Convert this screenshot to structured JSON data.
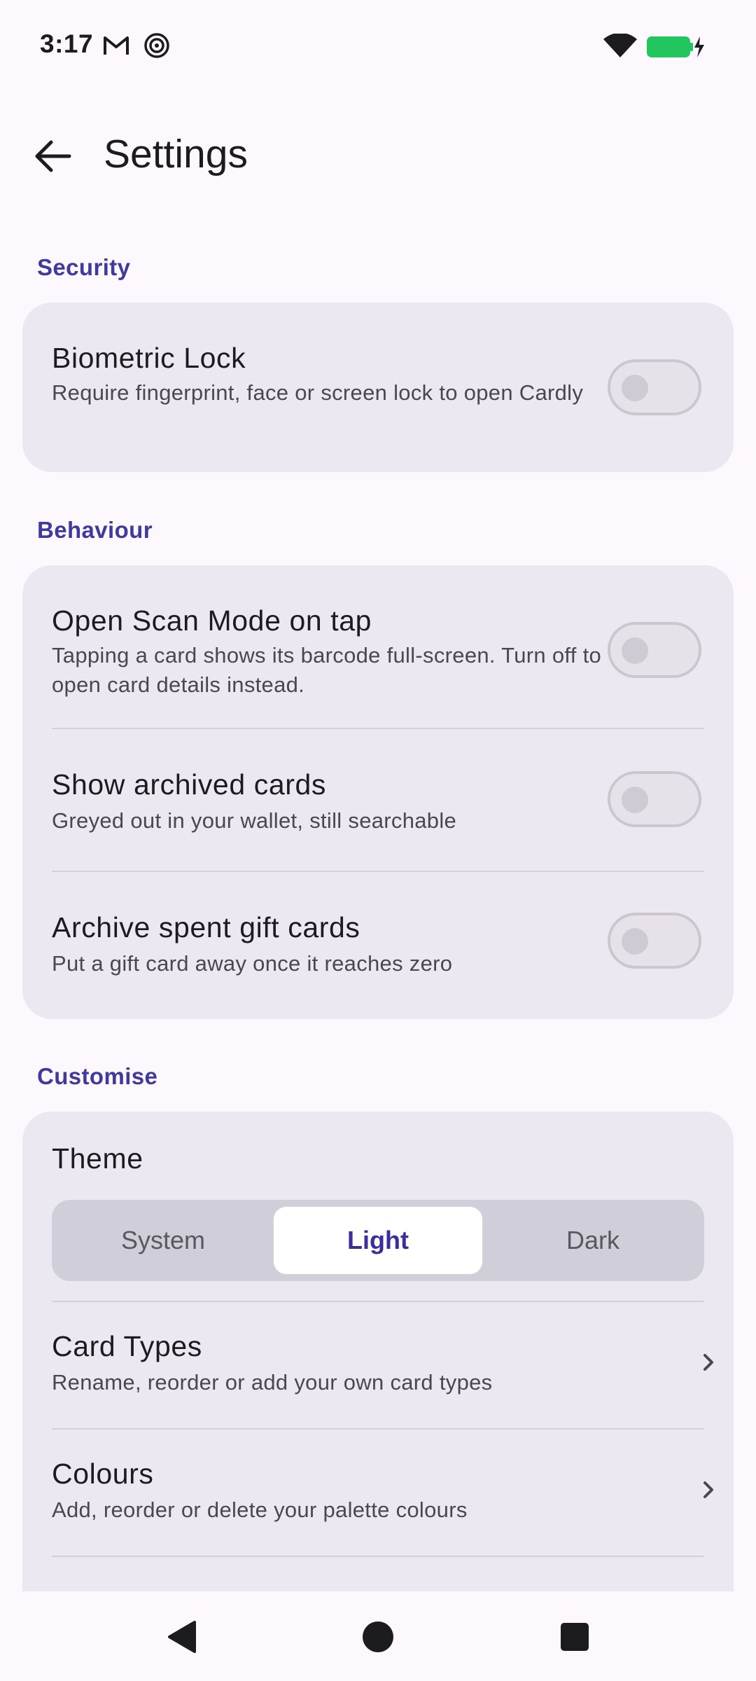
{
  "status_bar": {
    "time": "3:17",
    "icons": [
      "gmail-icon",
      "hotspot-icon",
      "wifi-icon",
      "battery-charging-icon"
    ],
    "battery_color": "#22c55e"
  },
  "app_bar": {
    "title": "Settings",
    "back_icon": "arrow-back-icon"
  },
  "accent_color": "#3f3a9c",
  "sections": {
    "security": {
      "header": "Security",
      "biometric": {
        "title": "Biometric Lock",
        "subtitle": "Require fingerprint, face or screen lock to open Cardly",
        "enabled": false
      }
    },
    "behaviour": {
      "header": "Behaviour",
      "scan_mode": {
        "title": "Open Scan Mode on tap",
        "subtitle": "Tapping a card shows its barcode full-screen. Turn off to open card details instead.",
        "enabled": false
      },
      "archived": {
        "title": "Show archived cards",
        "subtitle": "Greyed out in your wallet, still searchable",
        "enabled": false
      },
      "archive_gift": {
        "title": "Archive spent gift cards",
        "subtitle": "Put a gift card away once it reaches zero",
        "enabled": false
      }
    },
    "customise": {
      "header": "Customise",
      "theme": {
        "title": "Theme",
        "options": [
          "System",
          "Light",
          "Dark"
        ],
        "selected": "Light"
      },
      "card_types": {
        "title": "Card Types",
        "subtitle": "Rename, reorder or add your own card types"
      },
      "colours": {
        "title": "Colours",
        "subtitle": "Add, reorder or delete your palette colours"
      }
    }
  },
  "nav_bar": {
    "buttons": [
      "nav-back-icon",
      "nav-home-icon",
      "nav-recents-icon"
    ]
  }
}
